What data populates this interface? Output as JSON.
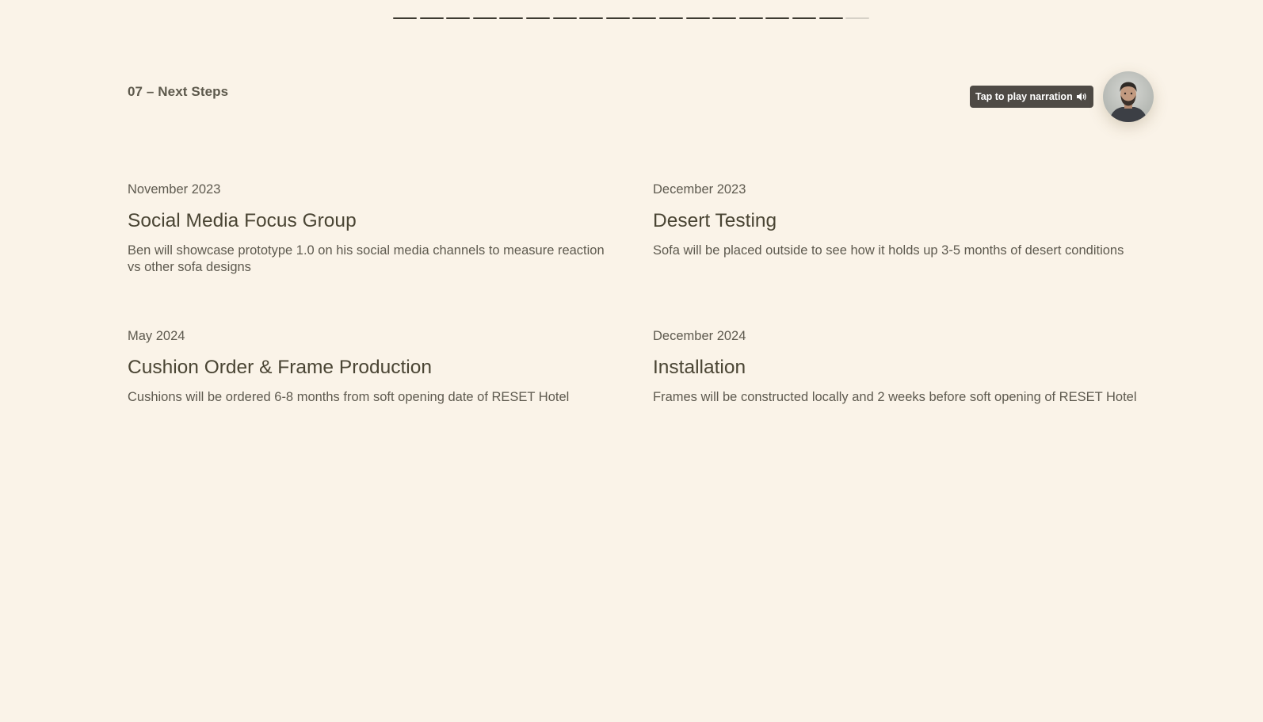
{
  "progress": {
    "total_segments": 18,
    "filled_segments": 17
  },
  "section": {
    "label": "07 – Next Steps"
  },
  "narration": {
    "label": "Tap to play narration",
    "icon": "speaker-icon"
  },
  "avatar": {
    "icon": "presenter-avatar"
  },
  "steps": [
    {
      "date": "November 2023",
      "title": "Social Media Focus Group",
      "description": "Ben will showcase prototype 1.0 on his social media channels to measure reaction vs other sofa designs"
    },
    {
      "date": "December 2023",
      "title": "Desert Testing",
      "description": "Sofa will be placed outside to see how it holds up 3-5 months of desert conditions"
    },
    {
      "date": "May 2024",
      "title": "Cushion Order & Frame Production",
      "description": "Cushions will be ordered 6-8 months from soft opening date of RESET Hotel"
    },
    {
      "date": "December 2024",
      "title": "Installation",
      "description": "Frames will be constructed locally and 2 weeks before soft opening of RESET Hotel"
    }
  ],
  "colors": {
    "background": "#faf3e8",
    "text_dark": "#4a4534",
    "text_muted": "#5e5a4f",
    "progress_filled": "#3d3a31",
    "progress_empty": "#d6d1c7",
    "narration_bg": "#4e4a45"
  }
}
